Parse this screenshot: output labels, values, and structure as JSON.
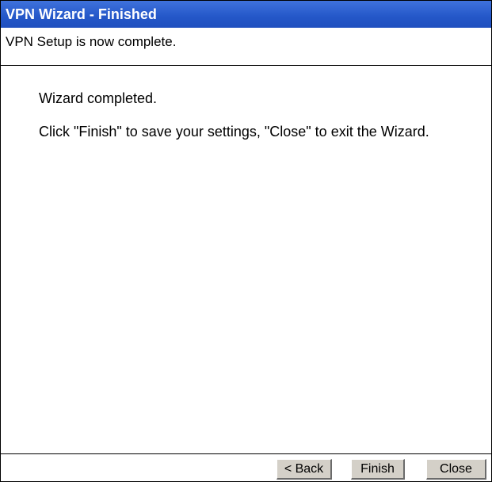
{
  "window": {
    "title": "VPN Wizard - Finished",
    "subtitle": "VPN Setup is now complete."
  },
  "content": {
    "line1": "Wizard completed.",
    "line2": "Click \"Finish\" to save your settings, \"Close\" to exit the Wizard."
  },
  "buttons": {
    "back": "< Back",
    "finish": "Finish",
    "close": "Close"
  },
  "colors": {
    "titlebar": "#2457c8",
    "titlebar_text": "#ffffff",
    "button_face": "#d4d0c8"
  }
}
